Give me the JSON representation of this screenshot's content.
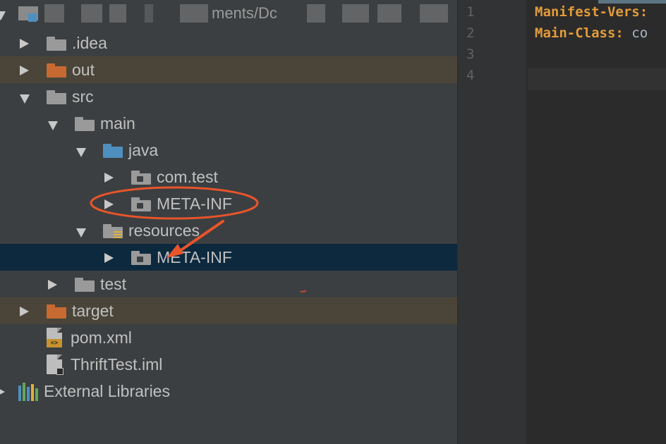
{
  "project_header": {
    "visible_fragment": "ments/Dc"
  },
  "tree": [
    {
      "label": ".idea",
      "depth": 1,
      "arrow": "right",
      "icon": "folder-gray",
      "excluded": false
    },
    {
      "label": "out",
      "depth": 1,
      "arrow": "right",
      "icon": "folder-orange",
      "excluded": true
    },
    {
      "label": "src",
      "depth": 1,
      "arrow": "down",
      "icon": "folder-gray",
      "excluded": false
    },
    {
      "label": "main",
      "depth": 2,
      "arrow": "down",
      "icon": "folder-gray",
      "excluded": false
    },
    {
      "label": "java",
      "depth": 3,
      "arrow": "down",
      "icon": "folder-blue",
      "excluded": false
    },
    {
      "label": "com.test",
      "depth": 4,
      "arrow": "right",
      "icon": "package",
      "excluded": false
    },
    {
      "label": "META-INF",
      "depth": 4,
      "arrow": "right",
      "icon": "package",
      "excluded": false
    },
    {
      "label": "resources",
      "depth": 3,
      "arrow": "down",
      "icon": "folder-resources",
      "excluded": false
    },
    {
      "label": "META-INF",
      "depth": 4,
      "arrow": "right",
      "icon": "package",
      "excluded": false,
      "selected": true
    },
    {
      "label": "test",
      "depth": 2,
      "arrow": "right",
      "icon": "folder-gray",
      "excluded": false
    },
    {
      "label": "target",
      "depth": 1,
      "arrow": "right",
      "icon": "folder-orange",
      "excluded": true
    },
    {
      "label": "pom.xml",
      "depth": 1,
      "arrow": "none",
      "icon": "xml-file",
      "excluded": false
    },
    {
      "label": "ThriftTest.iml",
      "depth": 1,
      "arrow": "none",
      "icon": "iml-file",
      "excluded": false
    },
    {
      "label": "External Libraries",
      "depth": 0,
      "arrow": "right",
      "icon": "libraries",
      "excluded": false
    }
  ],
  "editor": {
    "line_numbers": [
      "1",
      "2",
      "3",
      "4"
    ],
    "lines": [
      {
        "key": "Manifest-Vers:",
        "value": ""
      },
      {
        "key": "Main-Class:",
        "value": " co"
      },
      {
        "key": "",
        "value": ""
      },
      {
        "key": "",
        "value": ""
      }
    ]
  },
  "colors": {
    "panel_bg": "#3c3f41",
    "excluded_bg": "#4a4538",
    "selected_bg": "#0d293e",
    "annotation": "#e8552b",
    "manifest_key": "#e39c3a"
  }
}
